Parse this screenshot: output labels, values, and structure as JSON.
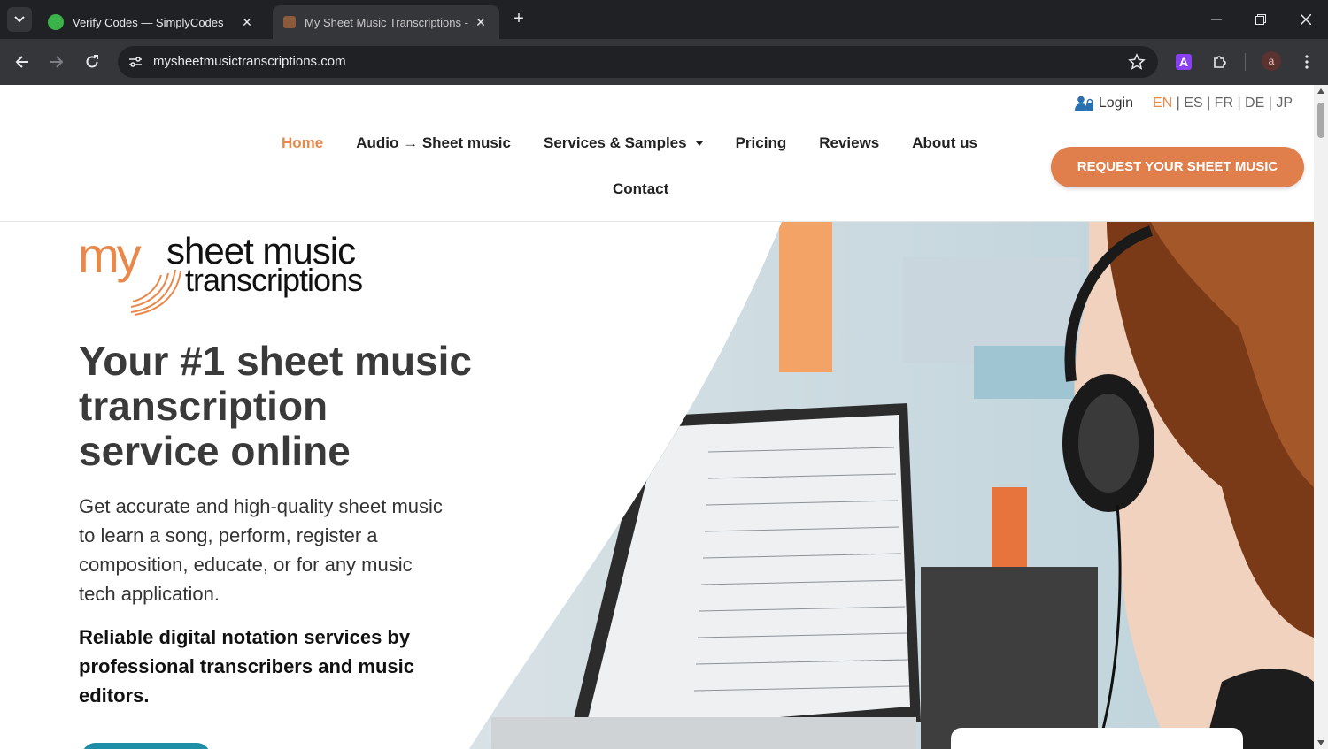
{
  "browser": {
    "tabs": [
      {
        "title": "Verify Codes — SimplyCodes",
        "active": false
      },
      {
        "title": "My Sheet Music Transcriptions - ",
        "active": true
      }
    ],
    "url": "mysheetmusictranscriptions.com",
    "profile_initial": "a",
    "extension_letter": "A"
  },
  "header": {
    "login_label": "Login",
    "languages": {
      "active": "EN",
      "rest": " | ES | FR | DE | JP"
    },
    "nav": [
      {
        "label": "Home",
        "active": true
      },
      {
        "label": "Audio → Sheet music"
      },
      {
        "label": "Services & Samples"
      },
      {
        "label": "Pricing"
      },
      {
        "label": "Reviews"
      },
      {
        "label": "About us"
      },
      {
        "label": "Contact"
      }
    ],
    "cta_label": "REQUEST YOUR SHEET MUSIC"
  },
  "logo": {
    "prefix": "my",
    "line1": "sheet music",
    "line2": "transcriptions"
  },
  "hero": {
    "headline_1": "Your #1 sheet music",
    "headline_2": "transcription",
    "headline_3": "service online",
    "lead_1": "Get accurate and high-quality sheet music",
    "lead_2": "to learn a song, perform, register a",
    "lead_3": "composition, educate, or for any music",
    "lead_4": "tech application.",
    "sub_1": "Reliable digital notation services by",
    "sub_2": "professional transcribers and music",
    "sub_3": "editors."
  },
  "colors": {
    "accent": "#e8884a",
    "cta": "#e07f4b",
    "teal": "#1e8fa6"
  }
}
